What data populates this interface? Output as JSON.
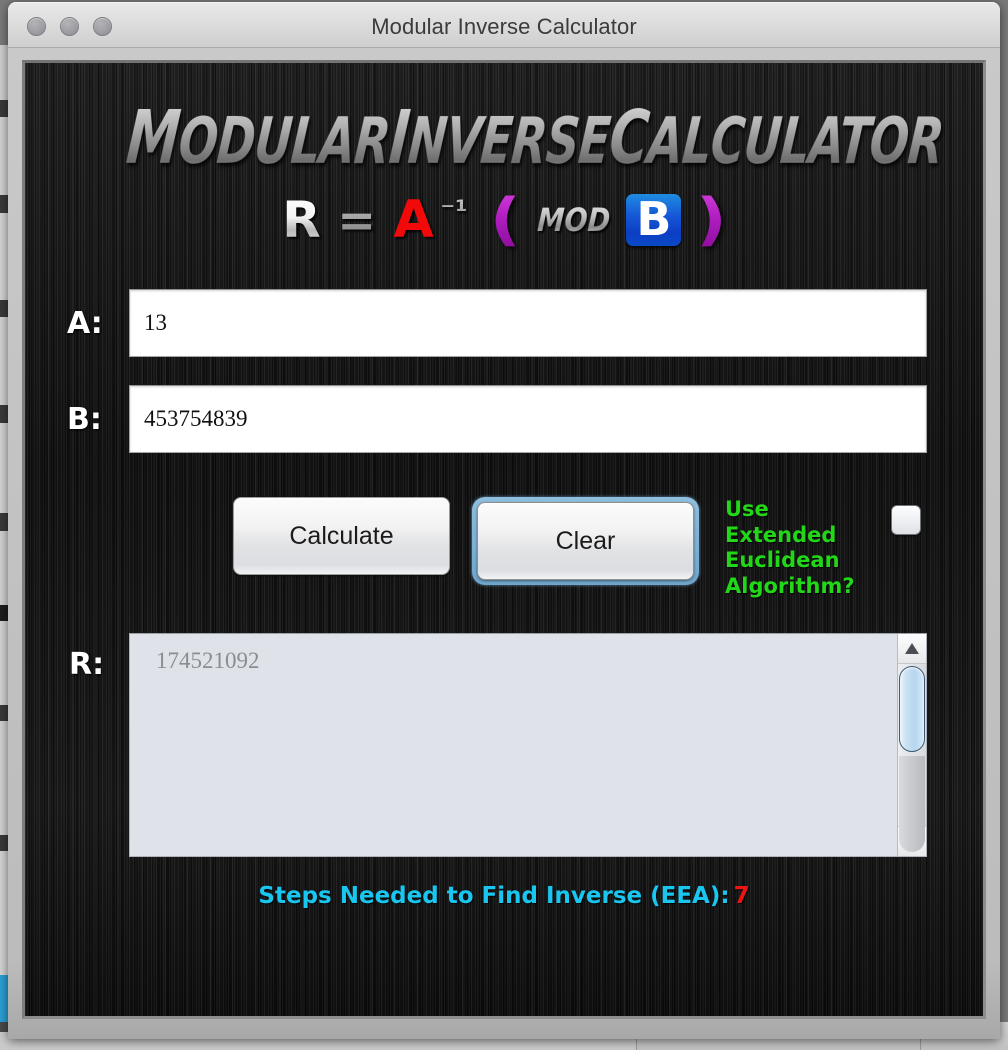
{
  "window": {
    "title": "Modular Inverse Calculator",
    "controls": [
      {
        "name": "close-button",
        "label": ""
      },
      {
        "name": "minimize-button",
        "label": ""
      },
      {
        "name": "maximize-button",
        "label": ""
      }
    ]
  },
  "logo": {
    "word1_cap": "M",
    "word1_rest": "ODULAR",
    "word2_cap": "I",
    "word2_rest": "NVERSE",
    "word3_cap": "C",
    "word3_rest": "ALCULATOR",
    "full_text": "MODULAR INVERSE CALCULATOR"
  },
  "formula": {
    "result_symbol": "R",
    "equals": "=",
    "operand_a": "A",
    "exponent": "⁻¹",
    "paren_left": "(",
    "mod_text": "MOD",
    "operand_b": "B",
    "paren_right": ")",
    "plain": "R = A^-1 (MOD B)"
  },
  "fields": {
    "a": {
      "label": "A:",
      "value": "13",
      "placeholder": ""
    },
    "b": {
      "label": "B:",
      "value": "453754839",
      "placeholder": ""
    }
  },
  "buttons": {
    "calculate": "Calculate",
    "clear": "Clear"
  },
  "options": {
    "eea_label": "Use Extended Euclidean Algorithm?",
    "eea_line1": "Use Extended",
    "eea_line2": "Euclidean",
    "eea_line3": "Algorithm?",
    "eea_checked": false
  },
  "result": {
    "label": "R:",
    "value": "174521092",
    "scrollbar": {
      "up_arrow": "▲",
      "down_arrow": "▼",
      "thumb_position_pct": 2
    }
  },
  "status": {
    "text": "Steps Needed to Find Inverse (EEA):",
    "count": "7"
  },
  "colors": {
    "accent_green": "#22d618",
    "accent_cyan": "#19c6ef",
    "accent_red": "#ef1414",
    "operand_a_red": "#f20a0a",
    "operand_b_blue": "#1659d8",
    "paren_magenta": "#b01ec0",
    "panel_dark": "#161616",
    "result_bg": "#dfe2e8",
    "focus_ring_blue": "#6fa4cb"
  }
}
